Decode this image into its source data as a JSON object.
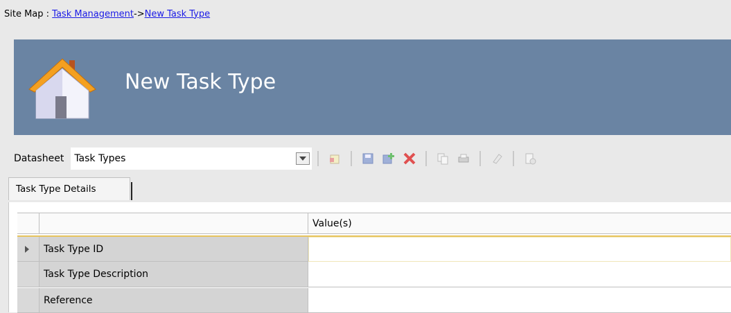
{
  "breadcrumb": {
    "prefix": "Site Map : ",
    "link1": "Task Management",
    "separator": "->",
    "link2": "New Task Type"
  },
  "banner": {
    "title": "New Task Type",
    "icon": "home-icon"
  },
  "toolbar": {
    "datasheet_label": "Datasheet",
    "datasheet_value": "Task Types",
    "buttons": [
      "new-record-icon",
      "save-icon",
      "save-add-icon",
      "delete-icon",
      "copy-icon",
      "print-icon",
      "clear-icon",
      "report-icon"
    ]
  },
  "tabs": [
    {
      "label": "Task Type Details"
    }
  ],
  "grid": {
    "columns": [
      "",
      "Value(s)"
    ],
    "rows": [
      {
        "label": "Task Type ID",
        "value": ""
      },
      {
        "label": "Task Type Description",
        "value": ""
      },
      {
        "label": "Reference",
        "value": ""
      }
    ]
  },
  "colors": {
    "banner": "#6a84a3",
    "link": "#1a1ae6",
    "delete": "#e05050"
  }
}
